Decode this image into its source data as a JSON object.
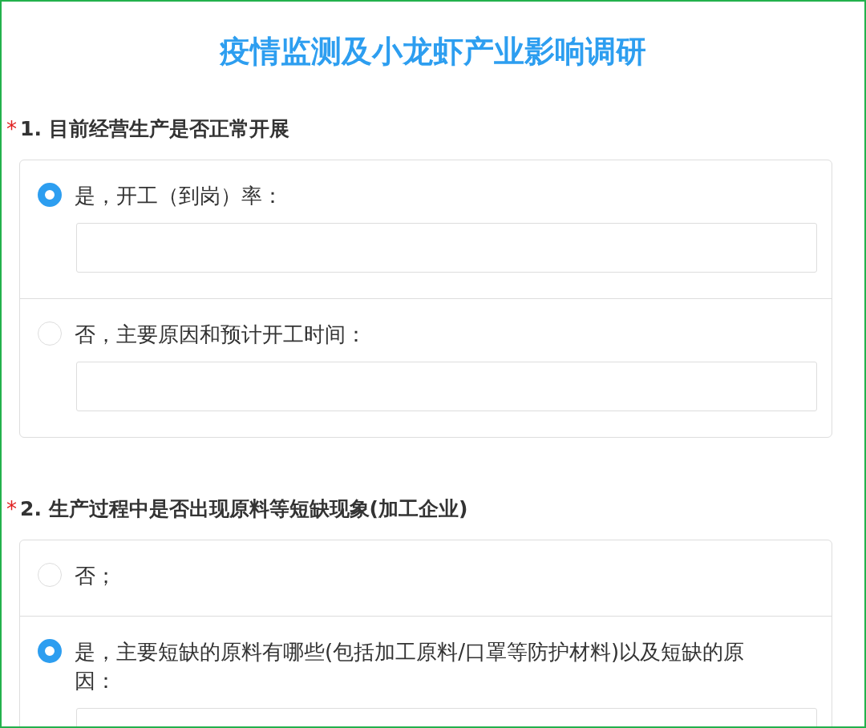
{
  "title": "疫情监测及小龙虾产业影响调研",
  "questions": [
    {
      "required_mark": "*",
      "title": "1. 目前经营生产是否正常开展",
      "options": [
        {
          "label": "是，开工（到岗）率：",
          "selected": true,
          "has_input": true
        },
        {
          "label": "否，主要原因和预计开工时间：",
          "selected": false,
          "has_input": true
        }
      ]
    },
    {
      "required_mark": "*",
      "title": "2. 生产过程中是否出现原料等短缺现象(加工企业)",
      "options": [
        {
          "label": "否；",
          "selected": false,
          "has_input": false
        },
        {
          "label": "是，主要短缺的原料有哪些(包括加工原料/口罩等防护材料)以及短缺的原因：",
          "selected": true,
          "has_input": true
        }
      ]
    }
  ]
}
